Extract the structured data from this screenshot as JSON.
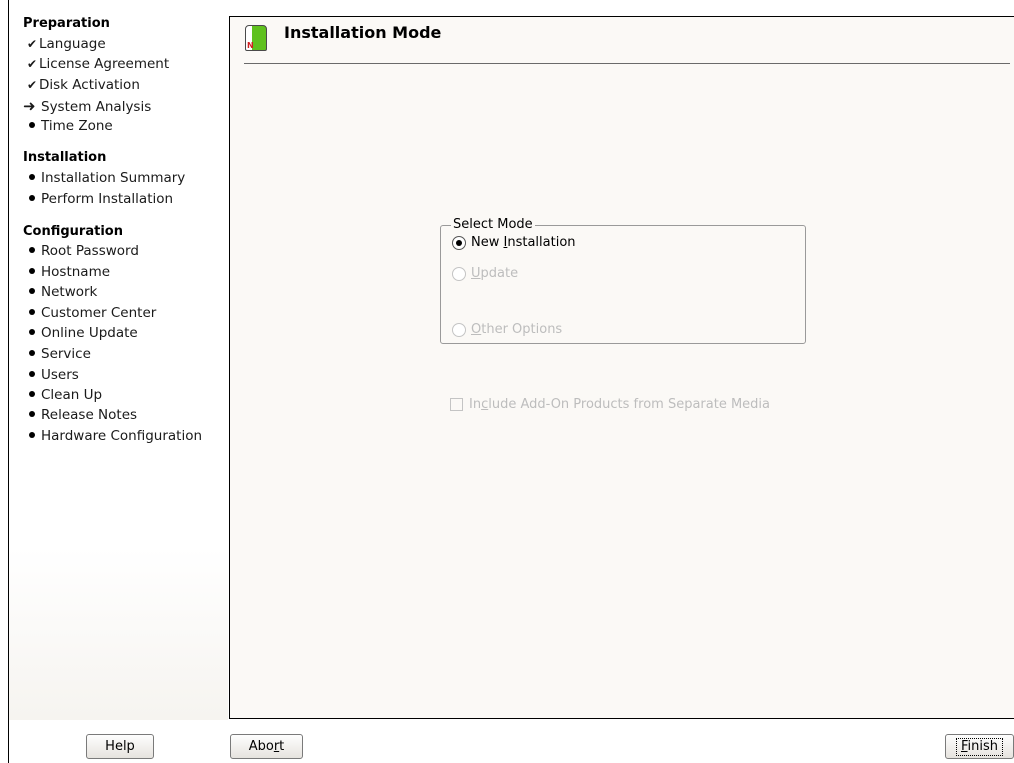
{
  "sidebar": {
    "sections": [
      {
        "title": "Preparation",
        "items": [
          {
            "label": "Language",
            "status": "done"
          },
          {
            "label": "License Agreement",
            "status": "done"
          },
          {
            "label": "Disk Activation",
            "status": "done"
          },
          {
            "label": "System Analysis",
            "status": "current"
          },
          {
            "label": "Time Zone",
            "status": "pending"
          }
        ]
      },
      {
        "title": "Installation",
        "items": [
          {
            "label": "Installation Summary",
            "status": "pending"
          },
          {
            "label": "Perform Installation",
            "status": "pending"
          }
        ]
      },
      {
        "title": "Configuration",
        "items": [
          {
            "label": "Root Password",
            "status": "pending"
          },
          {
            "label": "Hostname",
            "status": "pending"
          },
          {
            "label": "Network",
            "status": "pending"
          },
          {
            "label": "Customer Center",
            "status": "pending"
          },
          {
            "label": "Online Update",
            "status": "pending"
          },
          {
            "label": "Service",
            "status": "pending"
          },
          {
            "label": "Users",
            "status": "pending"
          },
          {
            "label": "Clean Up",
            "status": "pending"
          },
          {
            "label": "Release Notes",
            "status": "pending"
          },
          {
            "label": "Hardware Configuration",
            "status": "pending"
          }
        ]
      }
    ]
  },
  "header": {
    "title": "Installation Mode",
    "icon": "installation-mode-icon"
  },
  "mode_group": {
    "legend": "Select Mode",
    "options": [
      {
        "pre": "New ",
        "accel": "I",
        "post": "nstallation",
        "selected": true,
        "enabled": true
      },
      {
        "pre": "",
        "accel": "U",
        "post": "pdate",
        "selected": false,
        "enabled": false
      },
      {
        "pre": "",
        "accel": "O",
        "post": "ther Options",
        "selected": false,
        "enabled": false
      }
    ]
  },
  "addon_checkbox": {
    "pre": "In",
    "accel": "c",
    "post": "lude Add-On Products from Separate Media",
    "checked": false,
    "enabled": false
  },
  "buttons": {
    "help": "Help",
    "abort": {
      "pre": "Abo",
      "accel": "r",
      "post": "t"
    },
    "finish": {
      "pre": "",
      "accel": "F",
      "post": "inish"
    }
  },
  "colors": {
    "content_bg": "#fbf9f6",
    "icon_green": "#5fc11e",
    "disabled_text": "#bdbdbd"
  }
}
